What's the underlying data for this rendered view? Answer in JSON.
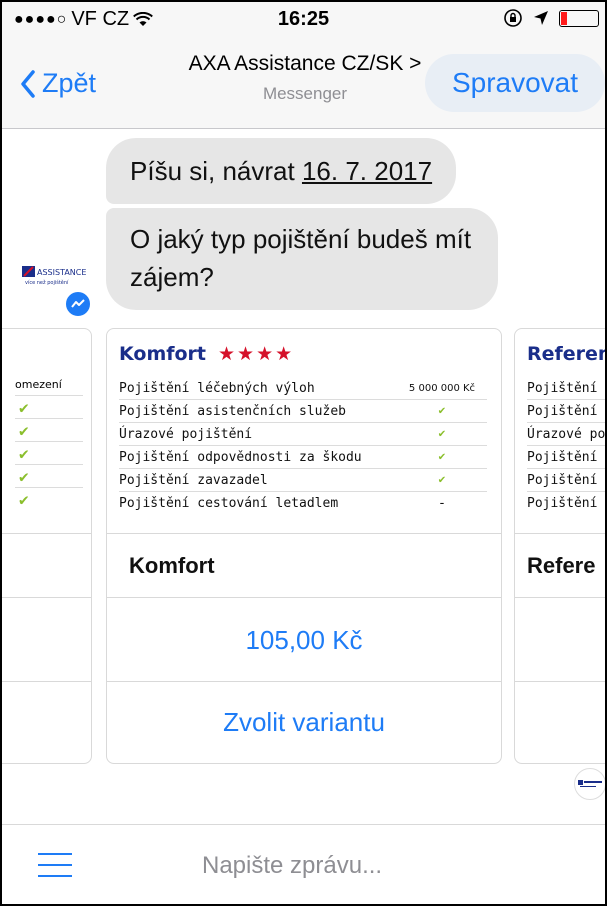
{
  "status": {
    "carrier": "VF CZ",
    "time": "16:25"
  },
  "nav": {
    "back_label": "Zpět",
    "title": "AXA Assistance CZ/SK >",
    "subtitle": "Messenger",
    "manage_label": "Spravovat"
  },
  "avatar": {
    "brand": "ASSISTANCE",
    "tagline": "více než pojištění"
  },
  "messages": [
    {
      "text_prefix": "Píšu si, návrat ",
      "underlined": "16. 7. 2017"
    },
    {
      "text": "O jaký typ pojištění budeš mít zájem?"
    }
  ],
  "cards": {
    "left": {
      "header_tail": "omezení",
      "checks": [
        "✔",
        "✔",
        "✔",
        "✔",
        "✔"
      ]
    },
    "main": {
      "title": "Komfort",
      "stars": "★★★★",
      "rows": [
        {
          "label": "Pojištění léčebných výloh",
          "value": "5 000 000 Kč"
        },
        {
          "label": "Pojištění asistenčních služeb",
          "value": "✔"
        },
        {
          "label": "Úrazové pojištění",
          "value": "✔"
        },
        {
          "label": "Pojištění odpovědnosti za škodu",
          "value": "✔"
        },
        {
          "label": "Pojištění zavazadel",
          "value": "✔"
        },
        {
          "label": "Pojištění cestování letadlem",
          "value": "-"
        }
      ],
      "name": "Komfort",
      "price": "105,00 Kč",
      "action": "Zvolit variantu"
    },
    "right": {
      "title": "Referen",
      "rows": [
        "Pojištění lé",
        "Pojištění a",
        "Úrazové po",
        "Pojištění o",
        "Pojištění z",
        "Pojištění c"
      ],
      "name": "Refere"
    }
  },
  "composer": {
    "placeholder": "Napište zprávu..."
  },
  "colors": {
    "accent": "#1e7cf6",
    "card_title": "#1a2e8a",
    "stars": "#d5112a",
    "check": "#8bbf2d",
    "bubble": "#e6e6e6"
  }
}
